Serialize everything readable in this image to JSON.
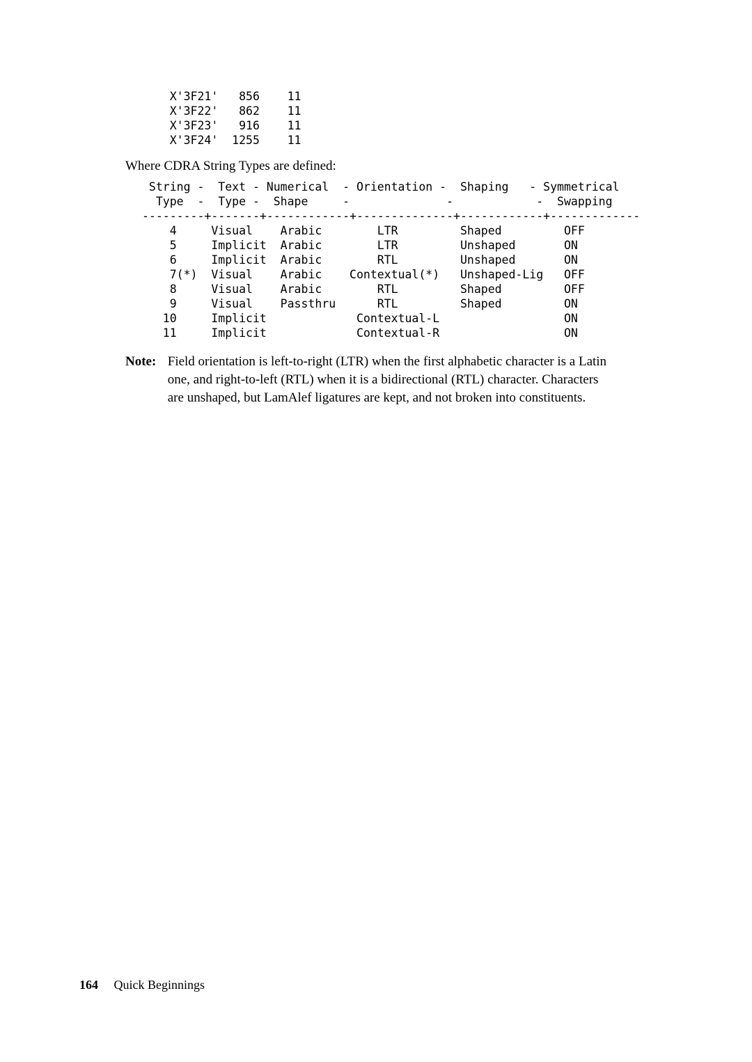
{
  "code_block_1": "    X'3F21'   856    11\n    X'3F22'   862    11\n    X'3F23'   916    11\n    X'3F24'  1255    11",
  "intro_text": "Where CDRA String Types are defined:",
  "code_block_2": " String -  Text - Numerical  - Orientation -  Shaping   - Symmetrical\n  Type  -  Type -  Shape     -              -            -  Swapping\n---------+-------+------------+--------------+------------+-------------\n    4     Visual    Arabic        LTR         Shaped         OFF\n    5     Implicit  Arabic        LTR         Unshaped       ON\n    6     Implicit  Arabic        RTL         Unshaped       ON\n    7(*)  Visual    Arabic    Contextual(*)   Unshaped-Lig   OFF\n    8     Visual    Arabic        RTL         Shaped         OFF\n    9     Visual    Passthru      RTL         Shaped         ON\n   10     Implicit             Contextual-L                  ON\n   11     Implicit             Contextual-R                  ON",
  "note_label": "Note:",
  "note_body": "Field orientation is left-to-right (LTR) when the first alphabetic character is a Latin one, and right-to-left (RTL) when it is a bidirectional (RTL) character. Characters are unshaped, but LamAlef ligatures are kept, and not broken into constituents.",
  "footer": {
    "page_number": "164",
    "title": "Quick Beginnings"
  }
}
